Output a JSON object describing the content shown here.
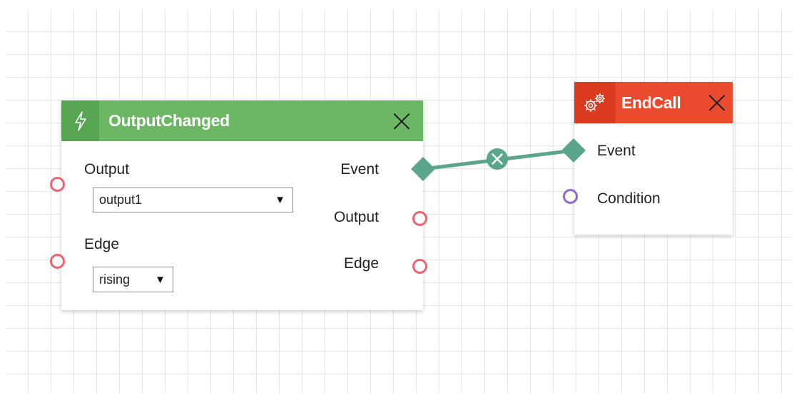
{
  "colors": {
    "trigger_header": "#6cb764",
    "trigger_icon_bg": "#57a550",
    "action_header": "#ea4a2e",
    "action_icon_bg": "#d93a20",
    "connection": "#5ba58a",
    "port_red": "#e8646e",
    "port_purple": "#9464cf",
    "grid": "#e6e6e6"
  },
  "nodes": {
    "output_changed": {
      "icon": "lightning-icon",
      "title": "OutputChanged",
      "inputs": [
        {
          "label": "Output",
          "select_value": "output1"
        },
        {
          "label": "Edge",
          "select_value": "rising"
        }
      ],
      "outputs": [
        "Event",
        "Output",
        "Edge"
      ]
    },
    "end_call": {
      "icon": "gears-icon",
      "title": "EndCall",
      "inputs": [
        "Event",
        "Condition"
      ]
    }
  },
  "connections": [
    {
      "from": "OutputChanged.Event",
      "to": "EndCall.Event",
      "delete_icon": "close-circle-icon"
    }
  ]
}
